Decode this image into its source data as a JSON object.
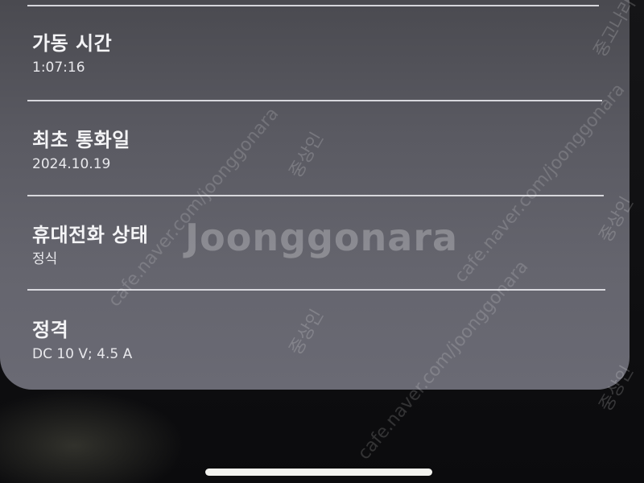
{
  "rows": [
    {
      "label": "가동 시간",
      "value": "1:07:16"
    },
    {
      "label": "최초 통화일",
      "value": "2024.10.19"
    },
    {
      "label": "휴대전화 상태",
      "value": "정식"
    },
    {
      "label": "정격",
      "value": "DC 10 V; 4.5 A"
    }
  ],
  "watermark": {
    "brand": "Joonggonara",
    "url": "cafe.naver.com/joonggonara",
    "site": "중고나라",
    "tag": "중상인"
  }
}
